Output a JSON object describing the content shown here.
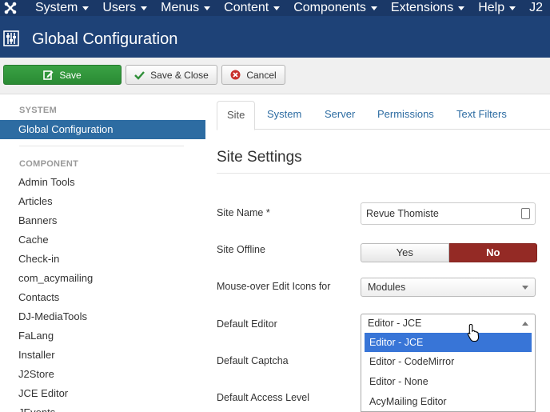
{
  "topbar": {
    "menu": [
      "System",
      "Users",
      "Menus",
      "Content",
      "Components",
      "Extensions",
      "Help",
      "J2"
    ]
  },
  "header": {
    "title": "Global Configuration"
  },
  "toolbar": {
    "save": "Save",
    "save_close": "Save & Close",
    "cancel": "Cancel"
  },
  "sidebar": {
    "system_heading": "SYSTEM",
    "active_item": "Global Configuration",
    "component_heading": "COMPONENT",
    "items": [
      "Admin Tools",
      "Articles",
      "Banners",
      "Cache",
      "Check-in",
      "com_acymailing",
      "Contacts",
      "DJ-MediaTools",
      "FaLang",
      "Installer",
      "J2Store",
      "JCE Editor",
      "JEvents"
    ]
  },
  "tabs": [
    "Site",
    "System",
    "Server",
    "Permissions",
    "Text Filters"
  ],
  "section_title": "Site Settings",
  "fields": {
    "site_name_label": "Site Name *",
    "site_name_value": "Revue Thomiste",
    "site_offline_label": "Site Offline",
    "offline_yes": "Yes",
    "offline_no": "No",
    "mouseover_label": "Mouse-over Edit Icons for",
    "mouseover_value": "Modules",
    "editor_label": "Default Editor",
    "editor_value": "Editor - JCE",
    "captcha_label": "Default Captcha",
    "access_label": "Default Access Level"
  },
  "editor_options": [
    "Editor - JCE",
    "Editor - CodeMirror",
    "Editor - None",
    "AcyMailing Editor"
  ],
  "colors": {
    "topbar": "#1a3867",
    "header": "#1e4277",
    "active": "#2d6ca2",
    "save": "#2f8f38",
    "no": "#942a25",
    "highlight": "#3875d7"
  }
}
